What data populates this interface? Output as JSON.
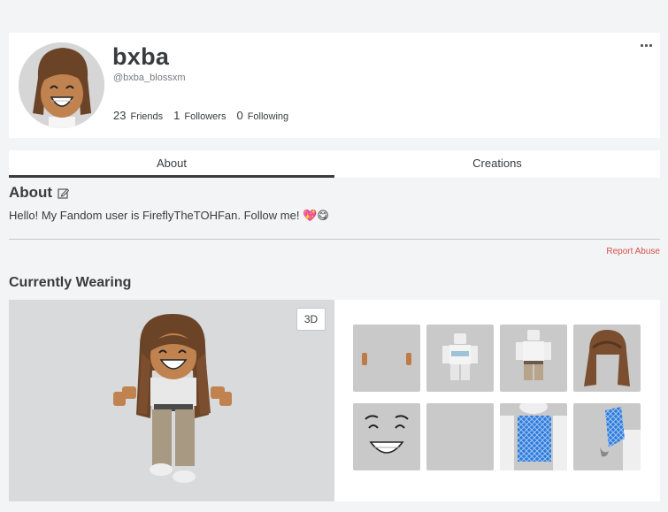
{
  "profile": {
    "display_name": "bxba",
    "handle": "@bxba_blossxm",
    "stats": [
      {
        "count": "23",
        "label": "Friends"
      },
      {
        "count": "1",
        "label": "Followers"
      },
      {
        "count": "0",
        "label": "Following"
      }
    ]
  },
  "tabs": [
    {
      "label": "About",
      "active": true
    },
    {
      "label": "Creations",
      "active": false
    }
  ],
  "about": {
    "title": "About",
    "bio": "Hello! My Fandom user is FireflyTheTOHFan. Follow me! 💖😋",
    "report_label": "Report Abuse"
  },
  "wearing": {
    "title": "Currently Wearing",
    "view_toggle_label": "3D",
    "items": [
      {
        "icon": "hands-icon"
      },
      {
        "icon": "shirt-white-icon"
      },
      {
        "icon": "pants-beige-icon"
      },
      {
        "icon": "hair-brown-icon"
      },
      {
        "icon": "face-smile-icon"
      },
      {
        "icon": "empty-item-icon"
      },
      {
        "icon": "blue-mesh-top-icon"
      },
      {
        "icon": "blue-sleeve-icon"
      }
    ]
  },
  "colors": {
    "page_bg": "#f2f4f5",
    "accent_report": "#d8504b",
    "text_primary": "#393b3d",
    "text_secondary": "#757b80"
  }
}
